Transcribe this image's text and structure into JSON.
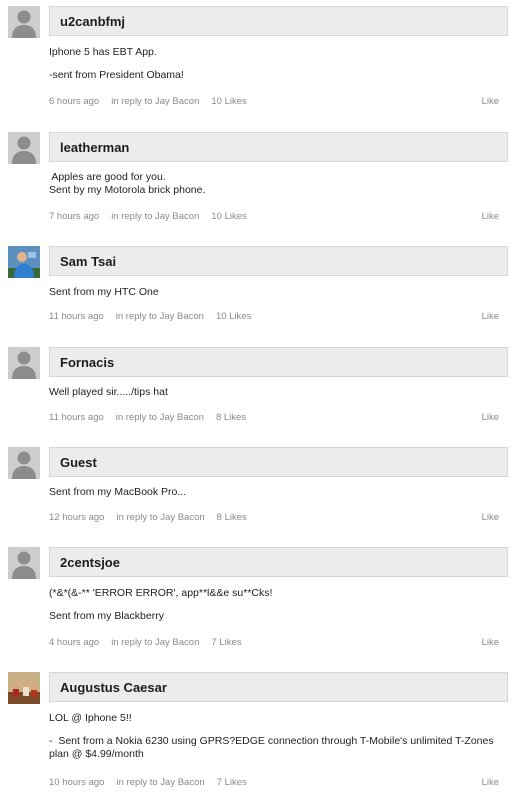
{
  "comments": [
    {
      "username": "u2canbfmj",
      "avatar": "default-avatar",
      "lines": [
        "Iphone 5 has EBT App.",
        "",
        "-sent from President Obama!"
      ],
      "time": "6 hours ago",
      "reply": "in reply to Jay Bacon",
      "likes": "10 Likes",
      "like_label": "Like"
    },
    {
      "username": "leatherman",
      "avatar": "default-avatar",
      "lines": [
        " Apples are good for you.",
        "Sent by my Motorola brick phone."
      ],
      "time": "7 hours ago",
      "reply": "in reply to Jay Bacon",
      "likes": "10 Likes",
      "like_label": "Like"
    },
    {
      "username": "Sam Tsai",
      "avatar": "photo-avatar",
      "lines": [
        "Sent from my HTC One"
      ],
      "time": "11 hours ago",
      "reply": "in reply to Jay Bacon",
      "likes": "10 Likes",
      "like_label": "Like"
    },
    {
      "username": "Fornacis",
      "avatar": "default-avatar",
      "lines": [
        "Well played sir...../tips hat"
      ],
      "time": "11 hours ago",
      "reply": "in reply to Jay Bacon",
      "likes": "8 Likes",
      "like_label": "Like"
    },
    {
      "username": "Guest",
      "avatar": "default-avatar",
      "lines": [
        "Sent from my MacBook Pro..."
      ],
      "time": "12 hours ago",
      "reply": "in reply to Jay Bacon",
      "likes": "8 Likes",
      "like_label": "Like"
    },
    {
      "username": "2centsjoe",
      "avatar": "default-avatar",
      "lines": [
        "(*&*(&-** 'ERROR ERROR', app**l&&e su**Cks!",
        "",
        "Sent from my Blackberry"
      ],
      "time": "4 hours ago",
      "reply": "in reply to Jay Bacon",
      "likes": "7 Likes",
      "like_label": "Like"
    },
    {
      "username": "Augustus Caesar",
      "avatar": "painting-avatar",
      "lines": [
        "LOL @ Iphone 5!!",
        "",
        "-  Sent from a Nokia 6230 using GPRS?EDGE connection through T-Mobile's unlimited T-Zones",
        "plan @ $4.99/month"
      ],
      "time": "10 hours ago",
      "reply": "in reply to Jay Bacon",
      "likes": "7 Likes",
      "like_label": "Like"
    }
  ]
}
